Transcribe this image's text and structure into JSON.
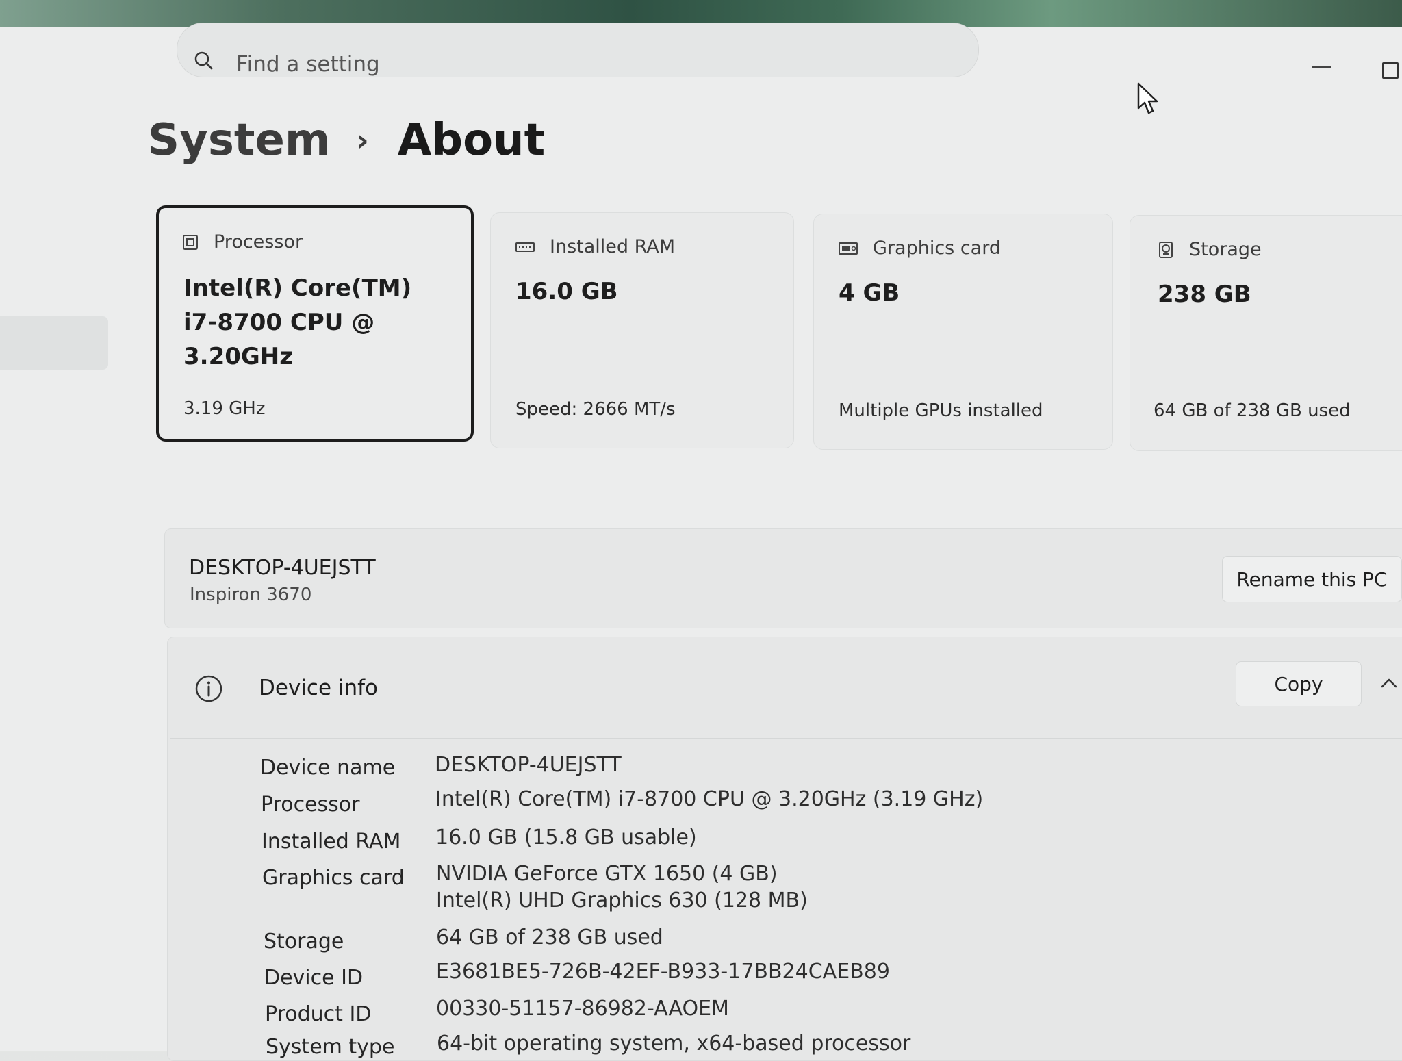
{
  "search": {
    "placeholder": "Find a setting"
  },
  "breadcrumb": {
    "parent": "System",
    "separator": "›",
    "current": "About"
  },
  "cards": [
    {
      "icon": "processor-icon",
      "title": "Processor",
      "value": "Intel(R) Core(TM)\ni7-8700 CPU @\n3.20GHz",
      "detail": "3.19 GHz",
      "selected": true
    },
    {
      "icon": "ram-icon",
      "title": "Installed RAM",
      "value": "16.0 GB",
      "detail": "Speed: 2666 MT/s",
      "selected": false
    },
    {
      "icon": "graphics-card-icon",
      "title": "Graphics card",
      "value": "4 GB",
      "detail": "Multiple GPUs installed",
      "selected": false
    },
    {
      "icon": "storage-icon",
      "title": "Storage",
      "value": "238 GB",
      "detail": "64 GB of 238 GB used",
      "selected": false
    }
  ],
  "pc": {
    "name": "DESKTOP-4UEJSTT",
    "model": "Inspiron 3670",
    "rename_label": "Rename this PC"
  },
  "device_info": {
    "title": "Device info",
    "copy_label": "Copy",
    "rows": [
      {
        "label": "Device name",
        "value": "DESKTOP-4UEJSTT"
      },
      {
        "label": "Processor",
        "value": "Intel(R) Core(TM) i7-8700 CPU @ 3.20GHz (3.19 GHz)"
      },
      {
        "label": "Installed RAM",
        "value": "16.0 GB (15.8 GB usable)"
      },
      {
        "label": "Graphics card",
        "value": "NVIDIA GeForce GTX 1650 (4 GB)",
        "value2": "Intel(R) UHD Graphics 630 (128 MB)"
      },
      {
        "label": "Storage",
        "value": "64 GB of 238 GB used"
      },
      {
        "label": "Device ID",
        "value": "E3681BE5-726B-42EF-B933-17BB24CAEB89"
      },
      {
        "label": "Product ID",
        "value": "00330-51157-86982-AAOEM"
      },
      {
        "label": "System type",
        "value": "64-bit operating system, x64-based processor"
      }
    ]
  },
  "colors": {
    "selected_border": "#1d1d1d",
    "text_primary": "#1e1e1e",
    "text_secondary": "#4a4a4a"
  }
}
